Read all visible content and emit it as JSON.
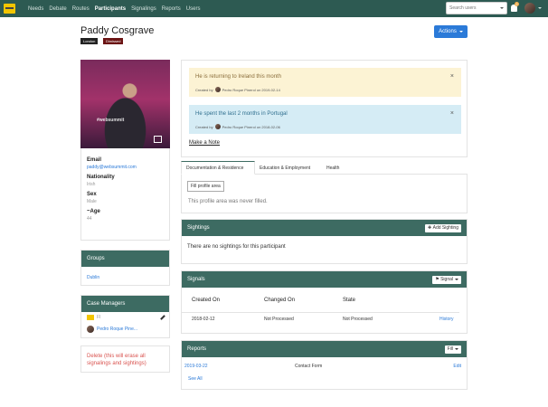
{
  "nav": {
    "items": [
      "Needs",
      "Debate",
      "Routes",
      "Participants",
      "Signalings",
      "Reports",
      "Users"
    ],
    "active": "Participants",
    "search_placeholder": "Search users",
    "notification_count": "2",
    "colors": {
      "nav_bg": "#2d5a52",
      "panel_header": "#3d6b62",
      "link": "#2b7ad8",
      "danger": "#d9534f"
    }
  },
  "header": {
    "name": "Paddy Cosgrave",
    "tags": [
      "London",
      "Dimissed"
    ],
    "actions_label": "Actions"
  },
  "profile": {
    "photo_text": "#websummit",
    "fields": [
      {
        "label": "Email",
        "value": "paddy@websummit.com"
      },
      {
        "label": "Nationality",
        "value": "Irish"
      },
      {
        "label": "Sex",
        "value": "Male"
      },
      {
        "label": "~Age",
        "value": "44"
      }
    ]
  },
  "groups": {
    "title": "Groups",
    "items": [
      "Dublin"
    ]
  },
  "case_managers": {
    "title": "Case Managers",
    "org": "FI",
    "manager": "Pedro Roque Pine..."
  },
  "delete_label": "Delete (this will erase all signalings and sightings)",
  "notes": [
    {
      "text": "He is returning to Ireland this month",
      "created_prefix": "Created by",
      "author": "Pedro Roque Pinerol",
      "date_text": "on 2019-02-14"
    },
    {
      "text": "He spent the last 2 months in Portugal",
      "created_prefix": "Created by",
      "author": "Pedro Roque Pinerol",
      "date_text": "on 2018-02-06"
    }
  ],
  "make_note_label": "Make a Note",
  "tabs": [
    "Documentation & Residence",
    "Education & Employment",
    "Health"
  ],
  "fill_profile_label": "Fill profile area",
  "empty_profile_text": "This profile area was never filled.",
  "sightings": {
    "title": "Sightings",
    "add_label": "Add Sighting",
    "empty_text": "There are no sightings for this participant"
  },
  "signals": {
    "title": "Signals",
    "button_label": "Signal",
    "columns": [
      "Created On",
      "Changed On",
      "State"
    ],
    "rows": [
      {
        "created": "2018-02-12",
        "changed": "Not Processed",
        "state": "Not Processed",
        "action": "History"
      }
    ]
  },
  "reports": {
    "title": "Reports",
    "button_label": "Fill",
    "rows": [
      {
        "date": "2019-03-22",
        "form": "Contact Form",
        "action": "Edit"
      }
    ],
    "see_all": "See All"
  }
}
